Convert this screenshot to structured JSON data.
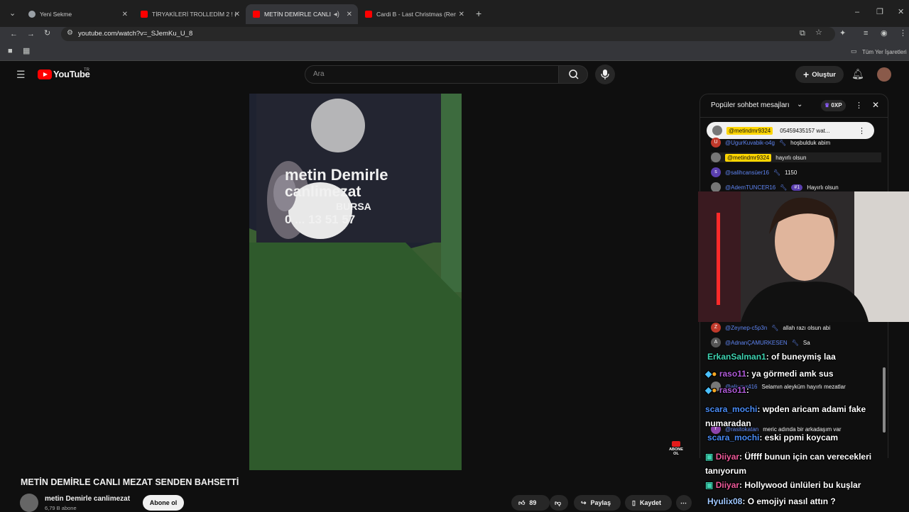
{
  "browser": {
    "tabs": [
      {
        "label": "Yeni Sekme"
      },
      {
        "label": "TİRYAKİLERİ TROLLEDİM 2 ! (%"
      },
      {
        "label": "METİN DEMİRLE CANLI ME"
      },
      {
        "label": "Cardi B - Last Christmas (Remi"
      }
    ],
    "url": "youtube.com/watch?v=_SJemKu_U_8",
    "bookmarks_label": "Tüm Yer İşaretleri"
  },
  "youtube": {
    "logo_text": "YouTube",
    "region": "TR",
    "search_placeholder": "Ara",
    "create_label": "Oluştur"
  },
  "video": {
    "banner_line1": "metin Demirle",
    "banner_line2": "canlimezat",
    "banner_line3": "BURSA",
    "banner_phone": "0 ... 13 51 57"
  },
  "watch": {
    "title": "METİN DEMİRLE CANLI MEZAT SENDEN BAHSETTİ",
    "channel_name": "metin Demirle canlimezat",
    "subscribers": "6,79 B abone",
    "subscribe_label": "Abone ol",
    "like_count": "89",
    "share_label": "Paylaş",
    "save_label": "Kaydet"
  },
  "chat": {
    "header_title": "Popüler sohbet mesajları",
    "points_label": "0XP",
    "pinned": {
      "author": "@metindmr9324",
      "text": "05459435157 wat..."
    },
    "messages": [
      {
        "avatar": "U",
        "author": "@UgurKuvabik-o4g",
        "text": "hoşbulduk abim"
      },
      {
        "avatar": "",
        "author": "@metindmr9324",
        "text": "hayırlı olsun"
      },
      {
        "avatar": "s",
        "author": "@salihcansüer16",
        "text": "1150"
      },
      {
        "avatar": "",
        "author": "@AdemTUNCER16",
        "badge": "#1",
        "text": "Hayırlı olsun"
      },
      {
        "avatar": "Z",
        "author": "@Zeynep-c5p3n",
        "text": "allah razı olsun abi"
      },
      {
        "avatar": "A",
        "author": "@AdnanÇAMURKESEN",
        "text": "Sa"
      },
      {
        "avatar": "",
        "author": "@aliugur416",
        "text": "Selamın aleyküm hayırlı mezatlar"
      },
      {
        "avatar": "r",
        "author": "@rasitokatan",
        "text": "meric adında bir arkadaşım var"
      }
    ]
  },
  "overlay_chat": [
    {
      "name": "ErkanSalman1",
      "text": ": of buneymiş laa"
    },
    {
      "name": "raso11",
      "text": ": ya görmedi amk sus"
    },
    {
      "name": "raso11",
      "text": ":"
    },
    {
      "name": "scara_mochi",
      "text": ": wpden aricam adami fake numaradan"
    },
    {
      "name": "scara_mochi",
      "text": ": eski ppmi koycam"
    },
    {
      "name": "Diiyar",
      "text": ": Üffff bunun için can verecekleri tanıyorum"
    },
    {
      "name": "Diiyar",
      "text": ": Hollywood ünlüleri bu kuşlar"
    },
    {
      "name": "Hyulix08",
      "text": ": O emojiyi nasıl attın ?"
    }
  ],
  "abone_badge": "ABONE OL"
}
